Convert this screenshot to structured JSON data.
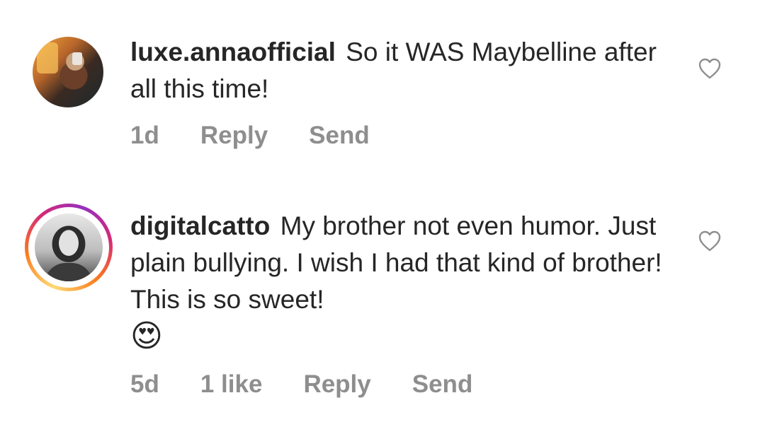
{
  "comments": [
    {
      "username": "luxe.annaofficial",
      "text": "So it WAS Maybelline after all this time!",
      "emoji": "",
      "time": "1d",
      "likes": "",
      "reply_label": "Reply",
      "send_label": "Send",
      "has_story": false
    },
    {
      "username": "digitalcatto",
      "text": "My brother not even humor. Just plain bullying. I wish I had that kind of brother! This is so sweet!",
      "emoji": "😍",
      "time": "5d",
      "likes": "1 like",
      "reply_label": "Reply",
      "send_label": "Send",
      "has_story": true
    }
  ],
  "icons": {
    "like": "heart-outline-icon"
  },
  "colors": {
    "text": "#262626",
    "meta": "#8e8e8e",
    "story_ring": [
      "#feda75",
      "#fa7e1e",
      "#d62976",
      "#962fbf"
    ]
  }
}
